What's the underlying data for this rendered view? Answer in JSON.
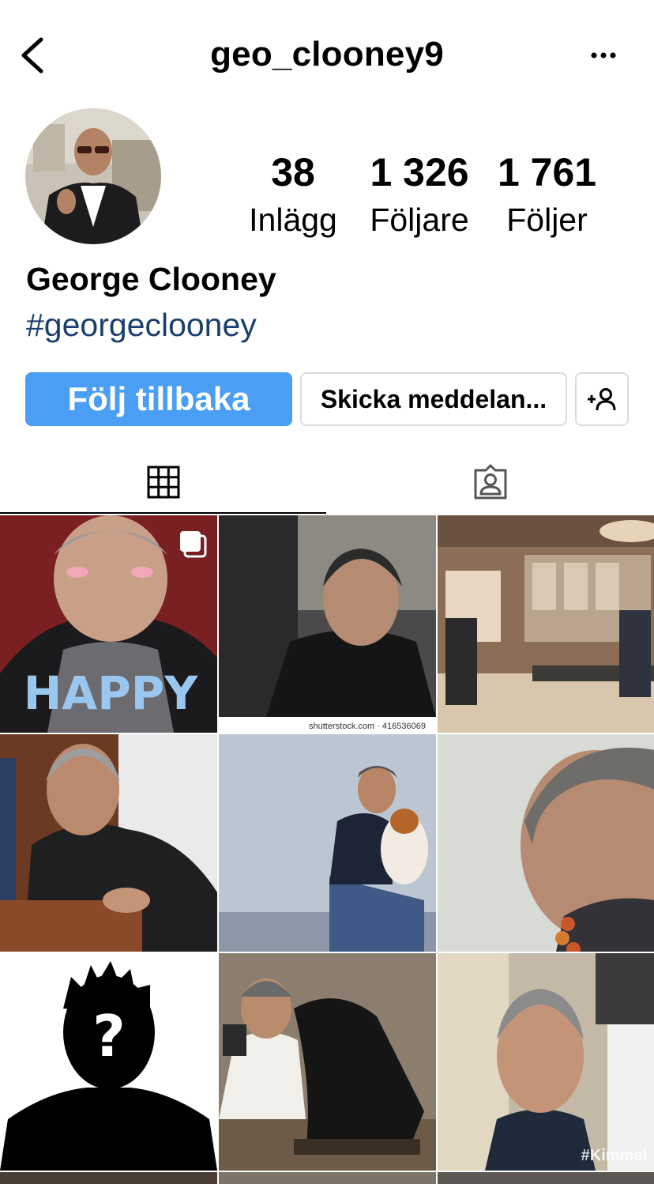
{
  "header": {
    "username": "geo_clooney9",
    "back_icon": "chevron-left-icon",
    "more_icon": "more-horizontal-icon"
  },
  "profile": {
    "display_name": "George Clooney",
    "bio_hashtag": "#georgeclooney",
    "stats": [
      {
        "value": "38",
        "label": "Inlägg"
      },
      {
        "value": "1 326",
        "label": "Följare"
      },
      {
        "value": "1 761",
        "label": "Följer"
      }
    ]
  },
  "actions": {
    "follow_back_label": "Följ tillbaka",
    "message_label": "Skicka meddelan...",
    "add_user_icon": "add-user-icon"
  },
  "tabs": [
    {
      "name": "grid",
      "icon": "grid-icon",
      "active": true
    },
    {
      "name": "tagged",
      "icon": "tagged-person-icon",
      "active": false
    }
  ],
  "posts": [
    {
      "overlay_text": "HAPPY",
      "multi": true
    },
    {
      "caption": "shutterstock.com · 416536069"
    },
    {},
    {},
    {},
    {},
    {
      "overlay_text": "?"
    },
    {},
    {
      "watermark": "#Kimmel"
    }
  ],
  "colors": {
    "accent": "#4a9ef3",
    "hashtag": "#1c3f6e",
    "border": "#dbdbdb"
  }
}
